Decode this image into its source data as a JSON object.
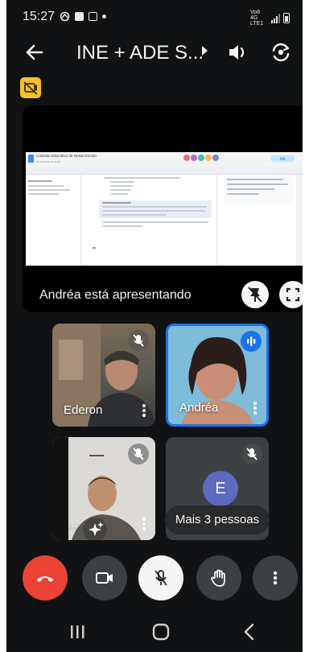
{
  "status_bar": {
    "time": "15:27",
    "network_label": "Vo8 4G LTE1"
  },
  "app_bar": {
    "title": "INE + ADE S..."
  },
  "presentation": {
    "label": "Andréa está apresentando",
    "document_name": "Contrato Educativo de Nossa Escola"
  },
  "participants": [
    {
      "name": "Ederon",
      "muted": true,
      "speaking": false
    },
    {
      "name": "Andréa",
      "muted": false,
      "speaking": true
    },
    {
      "name": "",
      "muted": true,
      "speaking": false
    },
    {
      "name": "",
      "avatar_letter": "E",
      "muted": true,
      "speaking": false
    }
  ],
  "more_people_label": "Mais 3 pessoas",
  "controls": [
    "end-call",
    "camera",
    "microphone",
    "raise-hand",
    "more-options"
  ],
  "colors": {
    "background": "#111213",
    "end_call": "#ea4335",
    "active_speaker_border": "#1a73e8",
    "badge": "#f6c026",
    "avatar_e": "#5c6bc0"
  }
}
